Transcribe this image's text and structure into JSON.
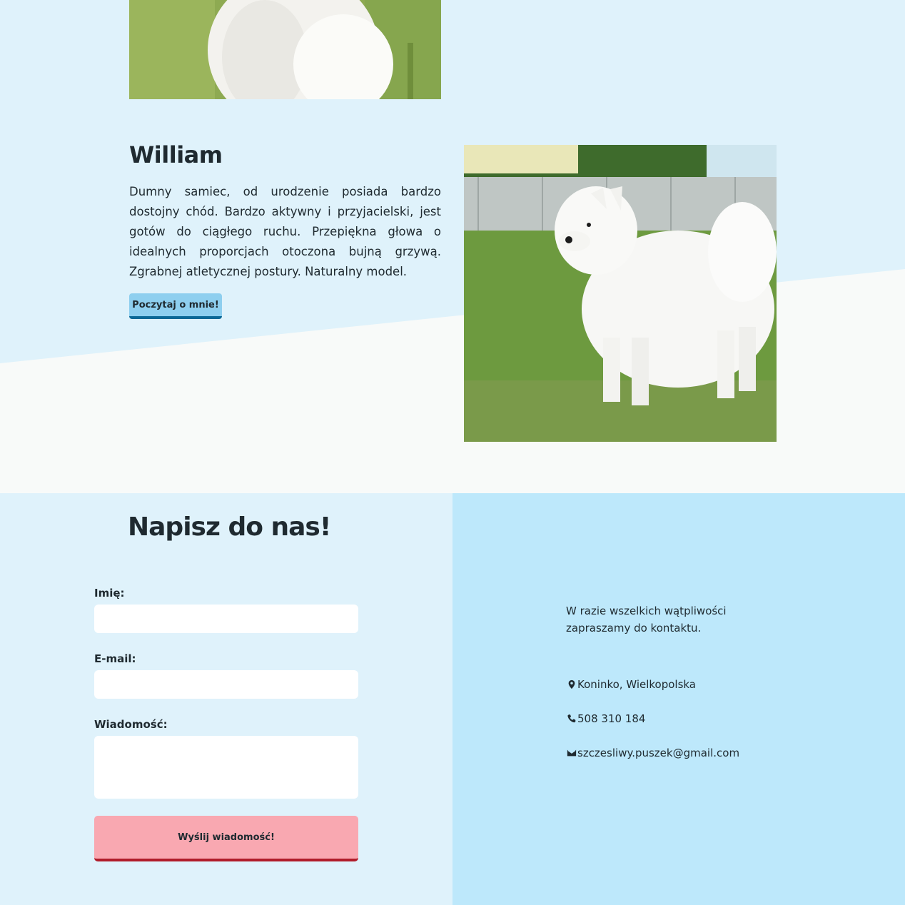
{
  "dog": {
    "name": "William",
    "description": "Dumny samiec, od urodzenie posiada bardzo dostojny chód. Bardzo aktywny i przyjacielski, jest gotów do ciągłego ruchu. Przepiękna głowa o idealnych proporcjach otoczona bujną grzywą. Zgrabnej atletycznej postury. Naturalny model.",
    "read_more_label": "Poczytaj o mnie!"
  },
  "contact_form": {
    "title": "Napisz do nas!",
    "name_label": "Imię:",
    "email_label": "E-mail:",
    "message_label": "Wiadomość:",
    "submit_label": "Wyślij wiadomość!",
    "name_value": "",
    "email_value": "",
    "message_value": ""
  },
  "contact_info": {
    "intro": "W razie wszelkich wątpliwości zapraszamy do kontaktu.",
    "location": "Koninko, Wielkopolska",
    "phone": "508 310 184",
    "email": "szczesliwy.puszek@gmail.com",
    "location_icon": "map-marker-icon",
    "phone_icon": "phone-icon",
    "email_icon": "envelope-icon"
  },
  "colors": {
    "background_light": "#dff2fb",
    "background_contact": "#bde8fb",
    "read_button": "#8ecfef",
    "read_button_border": "#0a6896",
    "send_button": "#f9a8b1",
    "send_button_border": "#b01c2a"
  }
}
